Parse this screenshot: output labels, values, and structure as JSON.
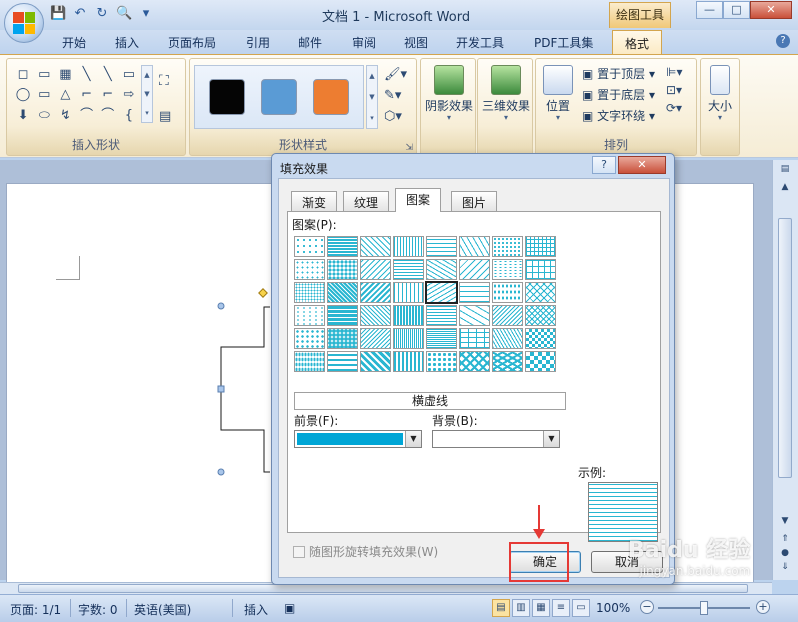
{
  "window": {
    "doc_title": "文档 1 - Microsoft Word",
    "contextual_tab_head": "绘图工具",
    "minimize": "—",
    "maximize": "□",
    "close": "✕"
  },
  "qat": {
    "save": "💾",
    "undo": "↶",
    "redo": "↻",
    "preview": "🔍",
    "more": "▾"
  },
  "tabs": [
    "开始",
    "插入",
    "页面布局",
    "引用",
    "邮件",
    "审阅",
    "视图",
    "开发工具",
    "PDF工具集",
    "格式"
  ],
  "active_tab": "格式",
  "help": "?",
  "ribbon": {
    "insert_shapes_label": "插入形状",
    "shape_styles_label": "形状样式",
    "shadow_label": "阴影效果",
    "threed_label": "三维效果",
    "position_label": "位置",
    "arrange_label": "排列",
    "size_label": "大小",
    "bring_to_front": "置于顶层",
    "send_to_back": "置于底层",
    "text_wrap": "文字环绕",
    "shape_glyphs": [
      "◻",
      "▭",
      "▦",
      "╲",
      "╲",
      "▭",
      "◯",
      "▭",
      "△",
      "⌐",
      "⌐",
      "⇨",
      "⬇",
      "⬭",
      "↯",
      "⌒",
      "⌒",
      "{"
    ],
    "swatches": [
      "#000000",
      "#5a9bd5",
      "#ed7d31"
    ]
  },
  "dialog": {
    "title": "填充效果",
    "help": "?",
    "close": "✕",
    "tabs": [
      "渐变",
      "纹理",
      "图案",
      "图片"
    ],
    "active_tab": "图案",
    "pattern_label": "图案(P):",
    "selected_pattern_name": "横虚线",
    "foreground_label": "前景(F):",
    "background_label": "背景(B):",
    "foreground_color": "#00a6d6",
    "background_color": "#ffffff",
    "sample_label": "示例:",
    "rotate_option": "随图形旋转填充效果(W)",
    "ok": "确定",
    "cancel": "取消",
    "pattern_color": "#29b6d1"
  },
  "status": {
    "page": "页面: 1/1",
    "words": "字数: 0",
    "language": "英语(美国)",
    "insert_mode": "插入",
    "zoom": "100%",
    "zoom_out": "−",
    "zoom_in": "+"
  },
  "watermark": {
    "logo": "Baidu 经验",
    "url": "jingyan.baidu.com"
  }
}
